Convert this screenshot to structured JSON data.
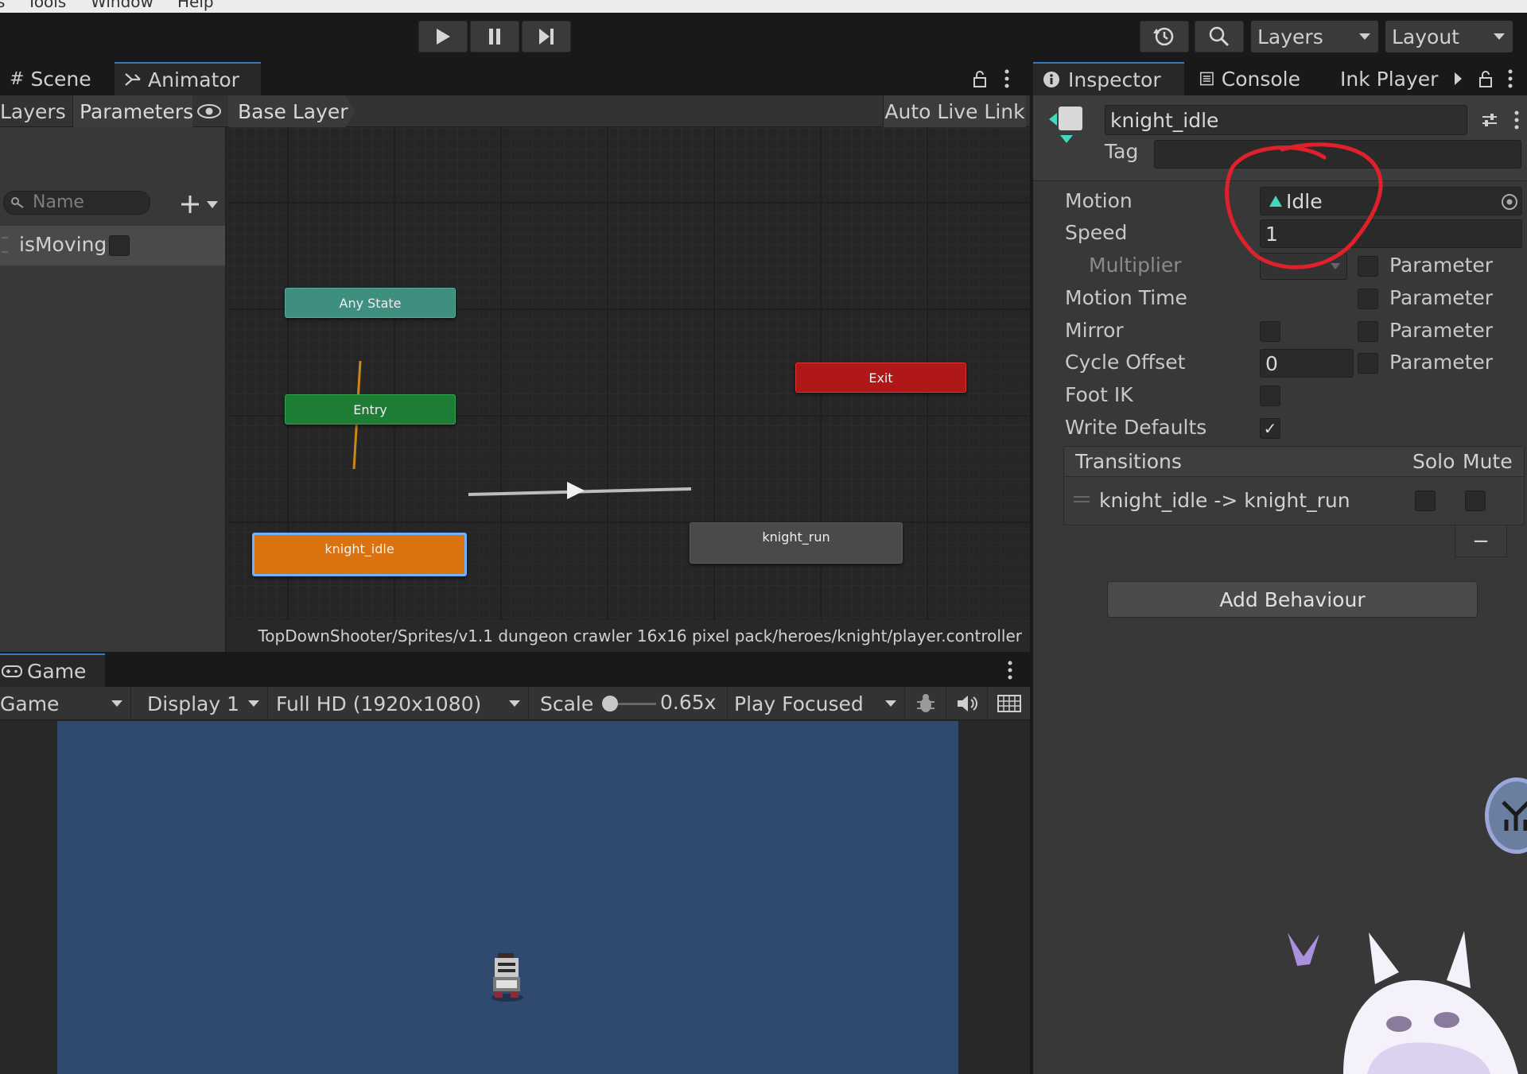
{
  "menu": {
    "items": [
      "s",
      "Tools",
      "Window",
      "Help"
    ]
  },
  "toolbar": {
    "layers_label": "Layers",
    "layout_label": "Layout"
  },
  "animator": {
    "tabs": [
      {
        "label": "Scene"
      },
      {
        "label": "Animator"
      }
    ],
    "subtabs": {
      "layers": "Layers",
      "parameters": "Parameters"
    },
    "breadcrumb": "Base Layer",
    "auto_live_link": "Auto Live Link",
    "search_placeholder": "Name",
    "parameters": [
      {
        "name": "isMoving",
        "checked": false
      }
    ],
    "nodes": {
      "any_state": "Any State",
      "entry": "Entry",
      "exit": "Exit",
      "knight_idle": "knight_idle",
      "knight_run": "knight_run"
    },
    "controller_path": "TopDownShooter/Sprites/v1.1 dungeon crawler 16x16 pixel pack/heroes/knight/player.controller"
  },
  "game": {
    "tab": "Game",
    "view_select": "Game",
    "display": "Display 1",
    "resolution": "Full HD (1920x1080)",
    "scale_label": "Scale",
    "scale_value": "0.65x",
    "play_focused": "Play Focused",
    "viewport_color": "#30496f"
  },
  "inspector": {
    "tabs": [
      {
        "label": "Inspector"
      },
      {
        "label": "Console"
      },
      {
        "label": "Ink Player"
      }
    ],
    "state_name": "knight_idle",
    "tag_label": "Tag",
    "tag_value": "",
    "motion": {
      "label": "Motion",
      "value": "Idle"
    },
    "speed": {
      "label": "Speed",
      "value": "1"
    },
    "multiplier": {
      "label": "Multiplier",
      "param": "Parameter"
    },
    "motion_time": {
      "label": "Motion Time",
      "param": "Parameter"
    },
    "mirror": {
      "label": "Mirror",
      "param": "Parameter"
    },
    "cycle_offset": {
      "label": "Cycle Offset",
      "value": "0",
      "param": "Parameter"
    },
    "foot_ik": {
      "label": "Foot IK",
      "checked": false
    },
    "write_defaults": {
      "label": "Write Defaults",
      "checked": true,
      "mark": "✓"
    },
    "transitions": {
      "header": "Transitions",
      "solo": "Solo",
      "mute": "Mute",
      "items": [
        {
          "label": "knight_idle -> knight_run"
        }
      ],
      "remove": "−"
    },
    "add_behaviour": "Add Behaviour"
  },
  "colors": {
    "accent": "#3a79bb",
    "annotation": "#e0202a",
    "any_state": "#3e8f80",
    "entry": "#1e7d34",
    "exit": "#b01818",
    "selected_state": "#d9720f",
    "default_state": "#4a4a4a"
  }
}
